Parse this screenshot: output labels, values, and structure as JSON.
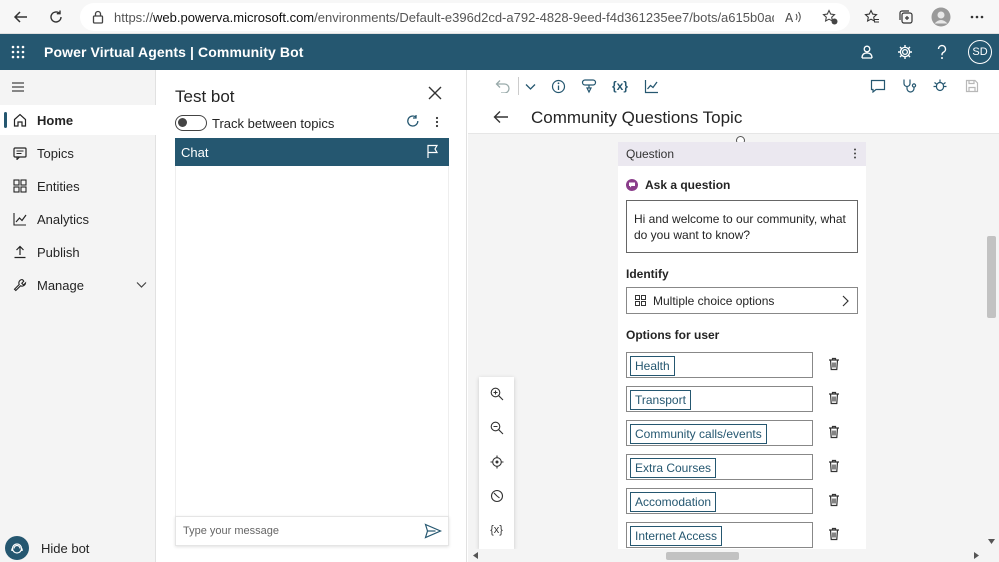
{
  "browser": {
    "url_prefix": "https://",
    "url_host": "web.powerva.microsoft.com",
    "url_path": "/environments/Default-e396d2cd-a792-4828-9eed-f4d361235ee7/bots/a615b0ad-ee3a-49b3-ad28-91..."
  },
  "header": {
    "app_title": "Power Virtual Agents | Community Bot",
    "avatar_initials": "SD"
  },
  "nav": {
    "items": [
      {
        "label": "Home",
        "icon": "home-icon",
        "active": true
      },
      {
        "label": "Topics",
        "icon": "topics-icon"
      },
      {
        "label": "Entities",
        "icon": "entities-icon"
      },
      {
        "label": "Analytics",
        "icon": "analytics-icon"
      },
      {
        "label": "Publish",
        "icon": "publish-icon"
      },
      {
        "label": "Manage",
        "icon": "manage-icon"
      }
    ],
    "hide_bot": "Hide bot"
  },
  "test_panel": {
    "title": "Test bot",
    "toggle_label": "Track between topics",
    "chat_header": "Chat",
    "message_placeholder": "Type your message"
  },
  "canvas": {
    "topic_title": "Community Questions Topic",
    "variables_label": "{x}",
    "question_node": {
      "header": "Question",
      "ask_label": "Ask a question",
      "question_text": "Hi and welcome to our community, what do you want to know?",
      "identify_label": "Identify",
      "identify_value": "Multiple choice options",
      "options_label": "Options for user",
      "options": [
        "Health",
        "Transport",
        "Community calls/events",
        "Extra Courses",
        "Accomodation",
        "Internet Access"
      ]
    },
    "zoom_palette": {
      "variables_label": "{x}"
    }
  },
  "colors": {
    "brand": "#255770",
    "question_header_bg": "#ebe8f0",
    "ask_icon": "#8a3d8a"
  }
}
